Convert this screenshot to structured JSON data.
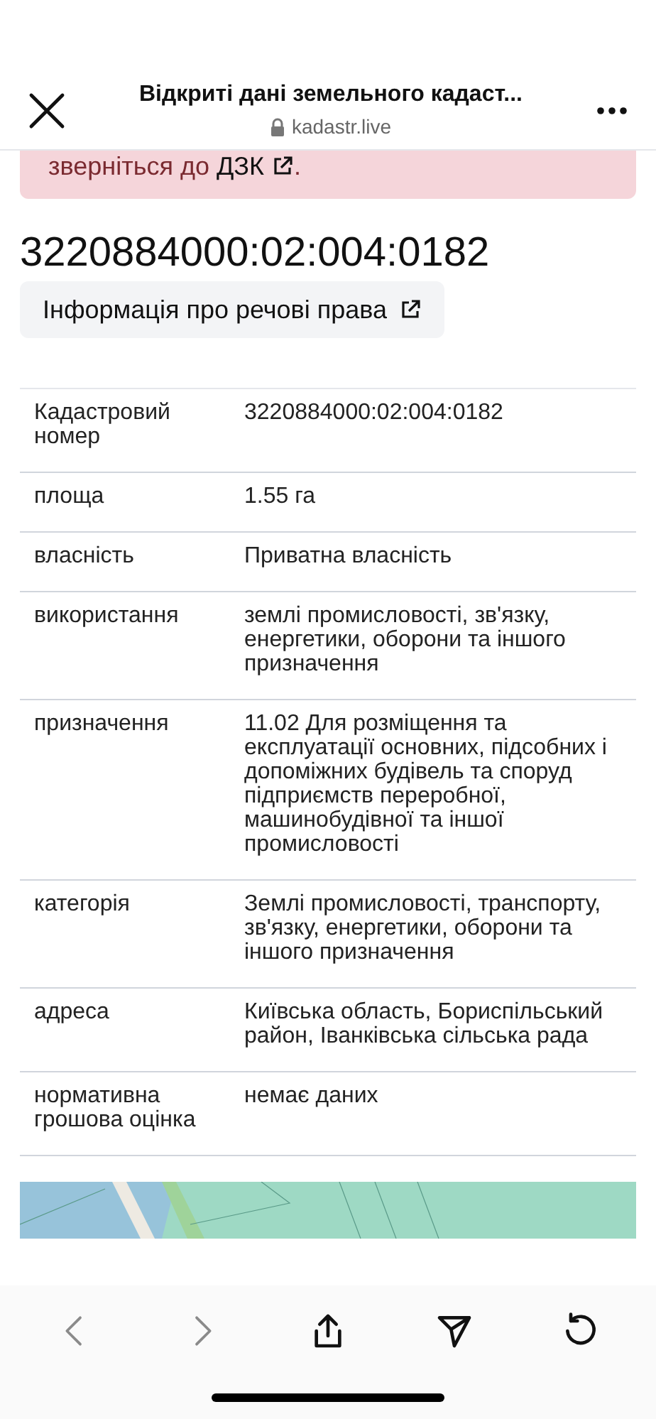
{
  "header": {
    "title": "Відкриті дані земельного кадаст...",
    "domain": "kadastr.live"
  },
  "alert": {
    "text": "зверніться до",
    "link": "ДЗК",
    "end": "."
  },
  "parcel": {
    "number": "3220884000:02:004:0182",
    "rights_button": "Інформація про речові права"
  },
  "table": {
    "rows": [
      {
        "label": "Кадастровий номер",
        "value": "3220884000:02:004:0182"
      },
      {
        "label": "площа",
        "value": "1.55 га"
      },
      {
        "label": "власність",
        "value": "Приватна власність"
      },
      {
        "label": "використання",
        "value": "землі промисловості, зв'язку, енергетики, оборони та іншого призначення"
      },
      {
        "label": "призначення",
        "value": "11.02 Для розміщення та експлуатації основних, підсобних і допоміжних будівель та споруд підприємств переробної, машинобудівної та іншої промисловості"
      },
      {
        "label": "категорія",
        "value": "Землі промисловості, транспорту, зв'язку, енергетики, оборони та іншого призначення"
      },
      {
        "label": "адреса",
        "value": "Київська область, Бориспільський район, Іванківська сільська рада"
      },
      {
        "label": "нормативна грошова оцінка",
        "value": "немає даних"
      }
    ]
  },
  "toolbar": [
    {
      "kind": "back",
      "disabled": true
    },
    {
      "kind": "forward",
      "disabled": true
    },
    {
      "kind": "share",
      "disabled": false
    },
    {
      "kind": "send",
      "disabled": false
    },
    {
      "kind": "reload",
      "disabled": false
    }
  ]
}
